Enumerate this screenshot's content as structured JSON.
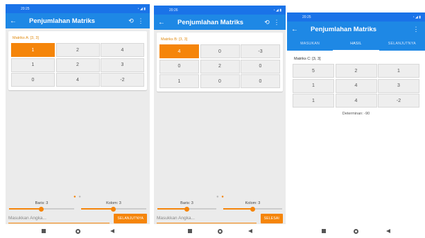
{
  "screens": [
    {
      "status_time": "20:25",
      "app_title": "Penjumlahan Matriks",
      "matrix_title": "Matriks A: [3, 3]",
      "cells": [
        "1",
        "2",
        "4",
        "1",
        "2",
        "3",
        "0",
        "4",
        "-2"
      ],
      "selected_index": 0,
      "baris_label": "Baris: 3",
      "kolom_label": "Kolom: 3",
      "input_placeholder": "Masukkan Angka...",
      "button_label": "SELANJUTNYA"
    },
    {
      "status_time": "20:26",
      "app_title": "Penjumlahan Matriks",
      "matrix_title": "Matriks B: [3, 3]",
      "cells": [
        "4",
        "0",
        "-3",
        "0",
        "2",
        "0",
        "1",
        "0",
        "0"
      ],
      "selected_index": 0,
      "baris_label": "Baris: 3",
      "kolom_label": "Kolom: 3",
      "input_placeholder": "Masukkan Angka...",
      "button_label": "SELESAI"
    },
    {
      "status_time": "20:25",
      "app_title": "Penjumlahan Matriks",
      "tabs": [
        "MASUKAN",
        "HASIL",
        "SELANJUTNYA"
      ],
      "active_tab": 1,
      "matrix_title": "Matriks C: [3, 3]",
      "cells": [
        "5",
        "2",
        "1",
        "1",
        "4",
        "3",
        "1",
        "4",
        "-2"
      ],
      "determinant": "Determinan: -90"
    }
  ],
  "colors": {
    "appbar": "#1e88e5",
    "accent": "#f5850a"
  },
  "icons": [
    "back-arrow-icon",
    "refresh-icon",
    "more-vert-icon",
    "nav-recent-icon",
    "nav-home-icon",
    "nav-back-icon"
  ]
}
